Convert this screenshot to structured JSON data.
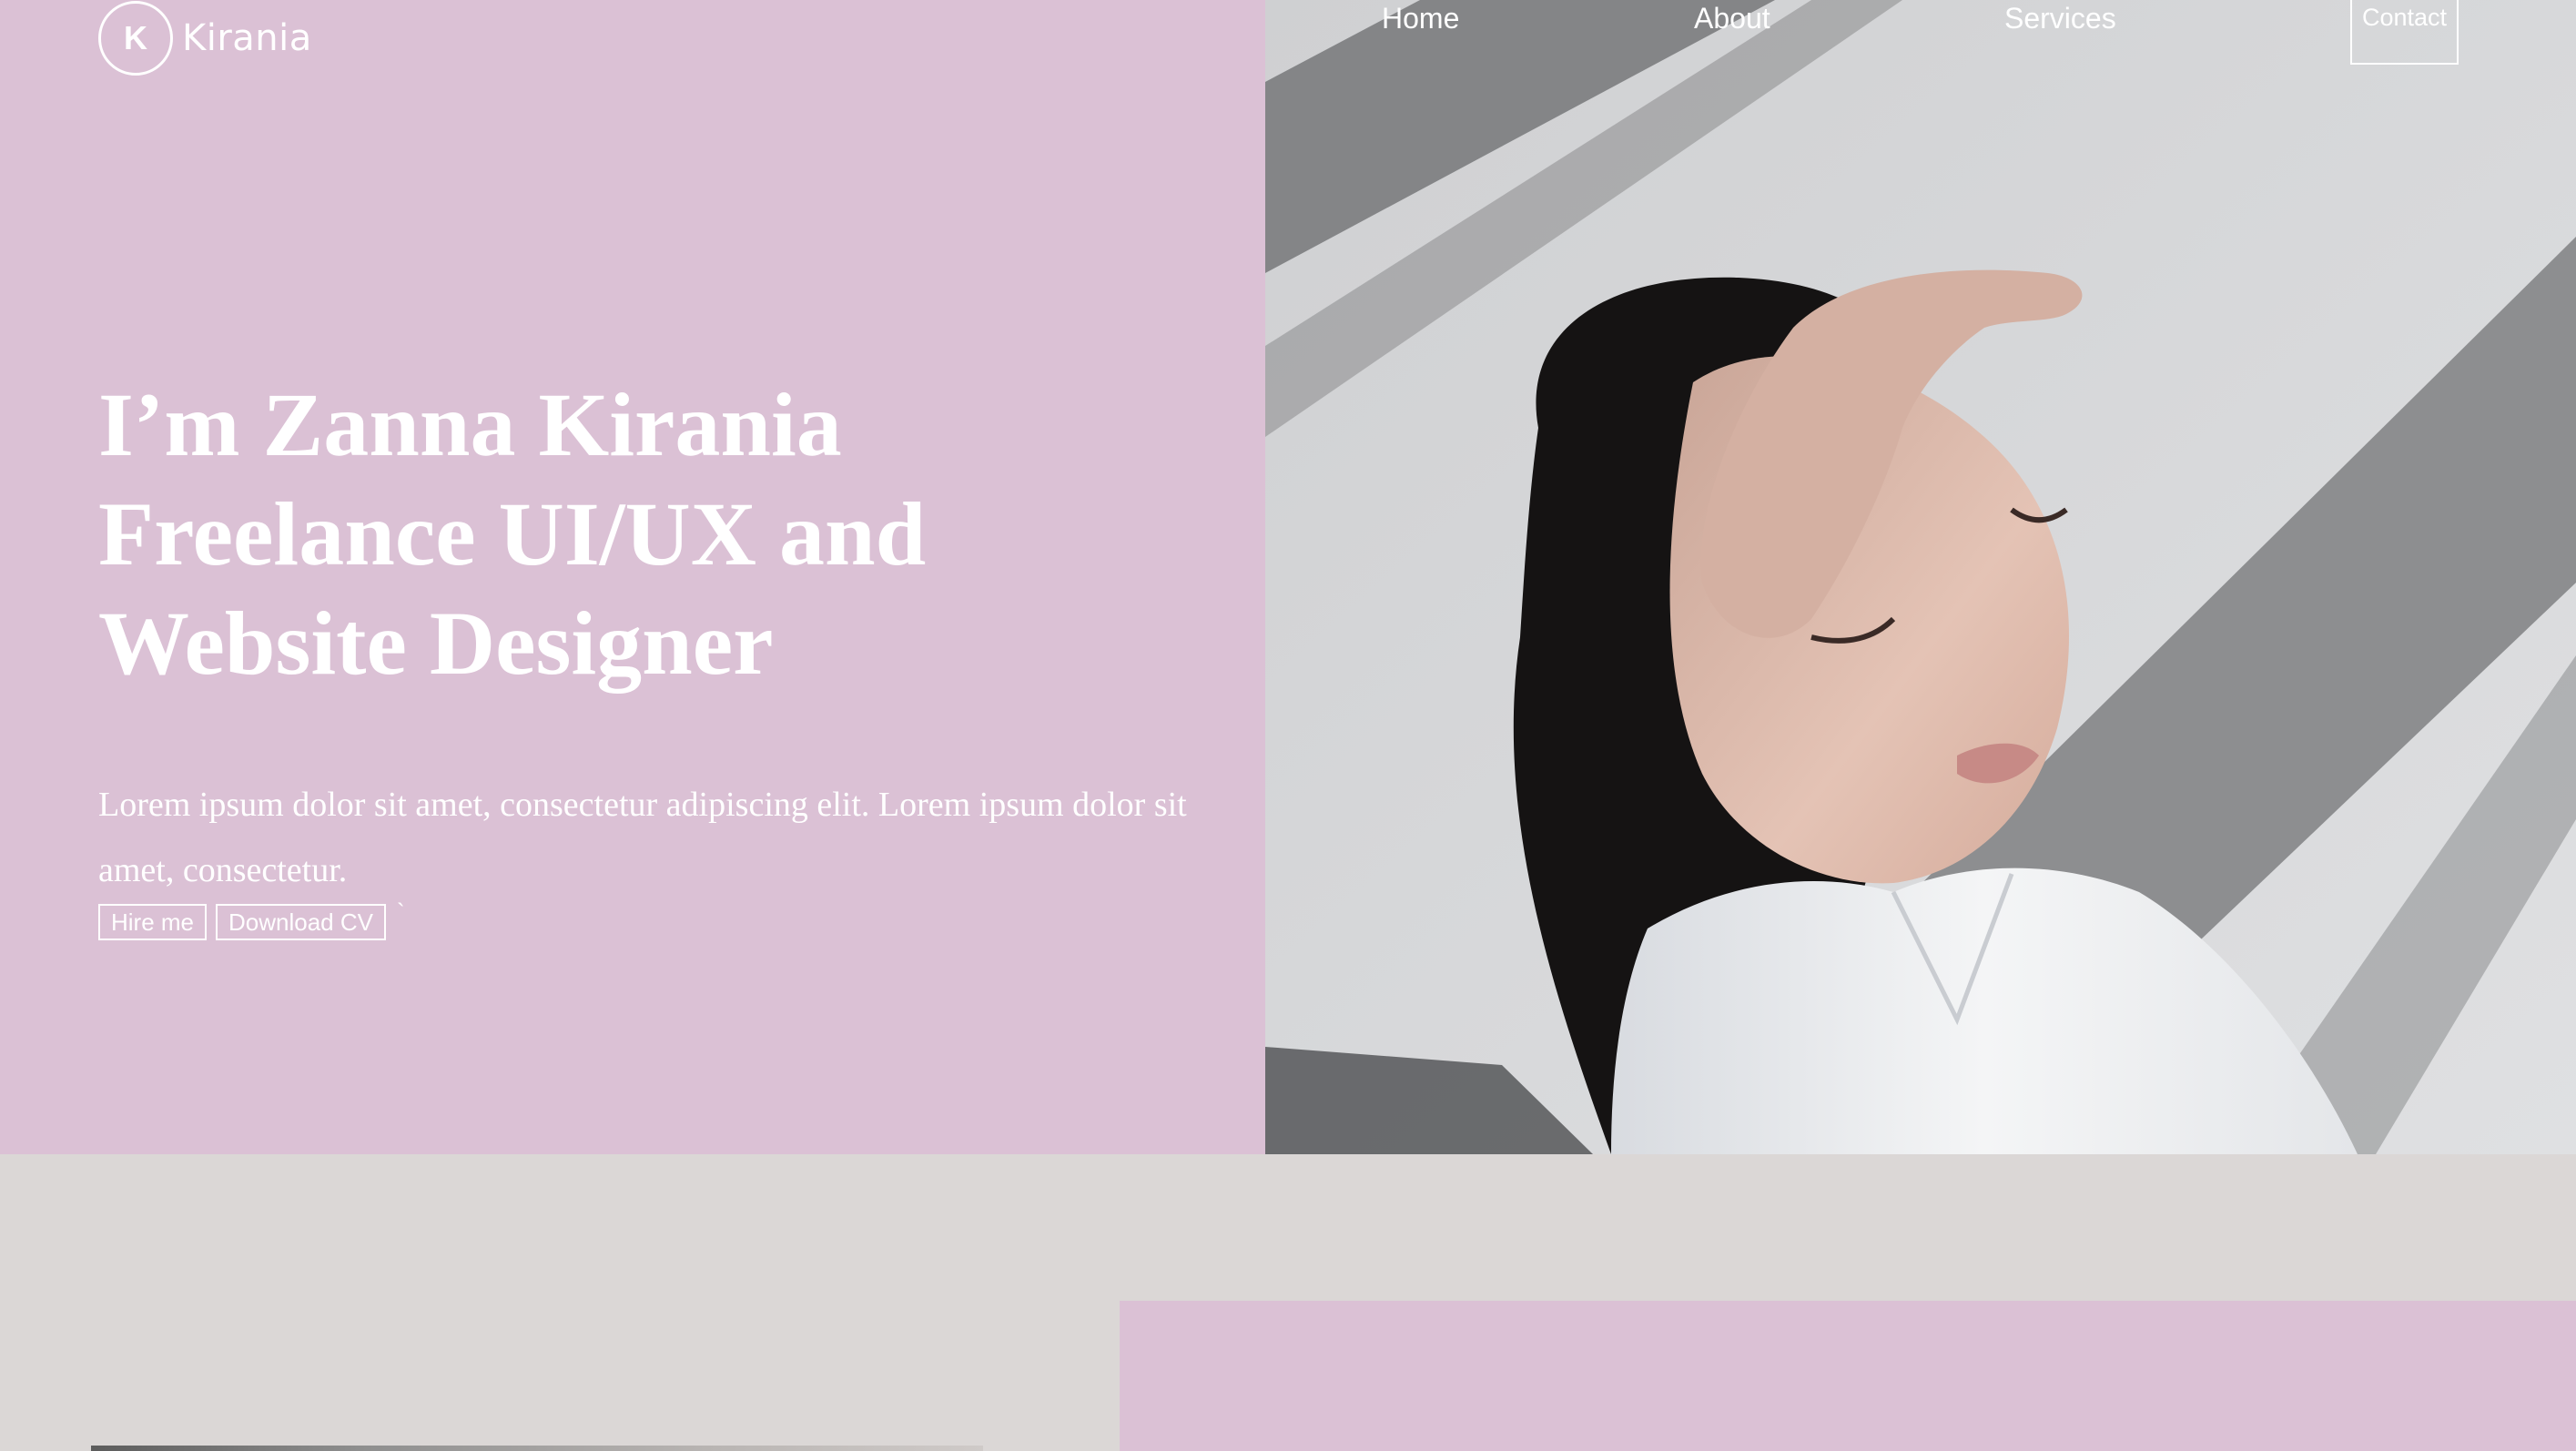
{
  "brand": {
    "logo_letter": "K",
    "logo_text": "Kirania"
  },
  "nav": {
    "items": [
      {
        "label": "Home"
      },
      {
        "label": "About"
      },
      {
        "label": "Services"
      },
      {
        "label": "Contact"
      }
    ]
  },
  "hero": {
    "headline_lines": [
      "I’m Zanna Kirania",
      "Freelance UI/UX and",
      "Website Designer"
    ],
    "intro": "Lorem ipsum dolor sit amet, consectetur adipiscing elit. Lorem ipsum dolor sit amet, consectetur.",
    "buttons": {
      "hire_label": "Hire me",
      "cv_label": "Download CV",
      "trailing_mark": "`"
    }
  },
  "colors": {
    "accent_pink": "#dbc1d5",
    "page_background": "#dbd7d6",
    "text_on_accent": "#ffffff"
  }
}
